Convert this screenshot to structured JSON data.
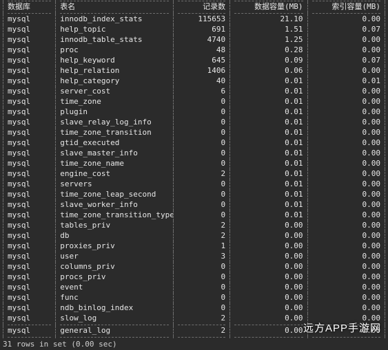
{
  "columns": {
    "db": "数据库",
    "table": "表名",
    "records": "记录数",
    "data_mb": "数据容量(MB)",
    "index_mb": "索引容量(MB)"
  },
  "rows": [
    {
      "db": "mysql",
      "table": "innodb_index_stats",
      "records": "115653",
      "data_mb": "21.10",
      "index_mb": "0.00"
    },
    {
      "db": "mysql",
      "table": "help_topic",
      "records": "691",
      "data_mb": "1.51",
      "index_mb": "0.07"
    },
    {
      "db": "mysql",
      "table": "innodb_table_stats",
      "records": "4740",
      "data_mb": "1.25",
      "index_mb": "0.00"
    },
    {
      "db": "mysql",
      "table": "proc",
      "records": "48",
      "data_mb": "0.28",
      "index_mb": "0.00"
    },
    {
      "db": "mysql",
      "table": "help_keyword",
      "records": "645",
      "data_mb": "0.09",
      "index_mb": "0.07"
    },
    {
      "db": "mysql",
      "table": "help_relation",
      "records": "1406",
      "data_mb": "0.06",
      "index_mb": "0.00"
    },
    {
      "db": "mysql",
      "table": "help_category",
      "records": "40",
      "data_mb": "0.01",
      "index_mb": "0.01"
    },
    {
      "db": "mysql",
      "table": "server_cost",
      "records": "6",
      "data_mb": "0.01",
      "index_mb": "0.00"
    },
    {
      "db": "mysql",
      "table": "time_zone",
      "records": "0",
      "data_mb": "0.01",
      "index_mb": "0.00"
    },
    {
      "db": "mysql",
      "table": "plugin",
      "records": "0",
      "data_mb": "0.01",
      "index_mb": "0.00"
    },
    {
      "db": "mysql",
      "table": "slave_relay_log_info",
      "records": "0",
      "data_mb": "0.01",
      "index_mb": "0.00"
    },
    {
      "db": "mysql",
      "table": "time_zone_transition",
      "records": "0",
      "data_mb": "0.01",
      "index_mb": "0.00"
    },
    {
      "db": "mysql",
      "table": "gtid_executed",
      "records": "0",
      "data_mb": "0.01",
      "index_mb": "0.00"
    },
    {
      "db": "mysql",
      "table": "slave_master_info",
      "records": "0",
      "data_mb": "0.01",
      "index_mb": "0.00"
    },
    {
      "db": "mysql",
      "table": "time_zone_name",
      "records": "0",
      "data_mb": "0.01",
      "index_mb": "0.00"
    },
    {
      "db": "mysql",
      "table": "engine_cost",
      "records": "2",
      "data_mb": "0.01",
      "index_mb": "0.00"
    },
    {
      "db": "mysql",
      "table": "servers",
      "records": "0",
      "data_mb": "0.01",
      "index_mb": "0.00"
    },
    {
      "db": "mysql",
      "table": "time_zone_leap_second",
      "records": "0",
      "data_mb": "0.01",
      "index_mb": "0.00"
    },
    {
      "db": "mysql",
      "table": "slave_worker_info",
      "records": "0",
      "data_mb": "0.01",
      "index_mb": "0.00"
    },
    {
      "db": "mysql",
      "table": "time_zone_transition_type",
      "records": "0",
      "data_mb": "0.01",
      "index_mb": "0.00"
    },
    {
      "db": "mysql",
      "table": "tables_priv",
      "records": "2",
      "data_mb": "0.00",
      "index_mb": "0.00"
    },
    {
      "db": "mysql",
      "table": "db",
      "records": "2",
      "data_mb": "0.00",
      "index_mb": "0.00"
    },
    {
      "db": "mysql",
      "table": "proxies_priv",
      "records": "1",
      "data_mb": "0.00",
      "index_mb": "0.00"
    },
    {
      "db": "mysql",
      "table": "user",
      "records": "3",
      "data_mb": "0.00",
      "index_mb": "0.00"
    },
    {
      "db": "mysql",
      "table": "columns_priv",
      "records": "0",
      "data_mb": "0.00",
      "index_mb": "0.00"
    },
    {
      "db": "mysql",
      "table": "procs_priv",
      "records": "0",
      "data_mb": "0.00",
      "index_mb": "0.00"
    },
    {
      "db": "mysql",
      "table": "event",
      "records": "0",
      "data_mb": "0.00",
      "index_mb": "0.00"
    },
    {
      "db": "mysql",
      "table": "func",
      "records": "0",
      "data_mb": "0.00",
      "index_mb": "0.00"
    },
    {
      "db": "mysql",
      "table": "ndb_binlog_index",
      "records": "0",
      "data_mb": "0.00",
      "index_mb": "0.00"
    },
    {
      "db": "mysql",
      "table": "slow_log",
      "records": "2",
      "data_mb": "0.00",
      "index_mb": "0.00"
    },
    {
      "db": "mysql",
      "table": "general_log",
      "records": "2",
      "data_mb": "0.00",
      "index_mb": "0.00"
    }
  ],
  "footer": "31 rows in set (0.00 sec)",
  "watermark": "远方APP手游网"
}
